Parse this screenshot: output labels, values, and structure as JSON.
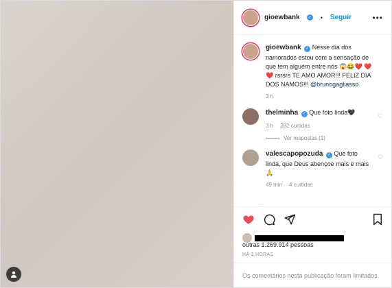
{
  "media": {
    "placeholder_note": ""
  },
  "header": {
    "username": "gioewbank",
    "separator": "•",
    "follow_label": "Seguir"
  },
  "caption": {
    "username": "gioewbank",
    "text": "Nesse dia dos namorados estou com a sensação de que tem alguém entre nós 😱😂❤️ ❤️❤️ rsrsrs TE AMO AMOR!!! FELIZ DIA DOS NAMOS!!!",
    "mention": "@brunogagliasso",
    "time": "3 h"
  },
  "comments": [
    {
      "username": "thelminha",
      "text": "Que foto linda🖤",
      "time": "3 h",
      "likes": "282 curtidas"
    },
    {
      "username": "valescapopozuda",
      "text": "Que foto linda, que Deus abençoe mais e mais🙏",
      "time": "49 min",
      "likes": "4 curtidas"
    }
  ],
  "replies_label": "Ver respostas (1)",
  "likes": {
    "suffix": "outras 1.269.914 pessoas"
  },
  "timestamp": "HÁ 3 HORAS",
  "footer": {
    "text": "Os comentários nesta publicação foram limitados."
  },
  "colors": {
    "link": "#0095f6",
    "verified": "#3897f0",
    "like": "#ed4956"
  }
}
